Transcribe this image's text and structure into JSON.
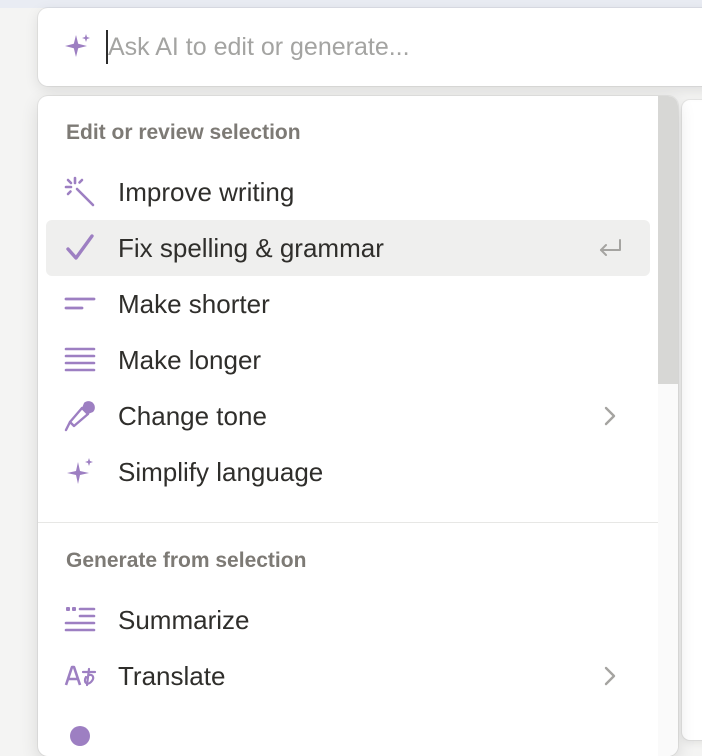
{
  "colors": {
    "accent": "#9d7fc2",
    "text": "#2f2e2b",
    "muted": "#7d7a75",
    "placeholder": "#a4a4a2",
    "selected_bg": "#efefee"
  },
  "ai_bar": {
    "icon": "sparkle-icon",
    "placeholder": "Ask AI to edit or generate..."
  },
  "menu": {
    "sections": [
      {
        "label": "Edit or review selection",
        "items": [
          {
            "label": "Improve writing",
            "icon": "magic-wand-icon"
          },
          {
            "label": "Fix spelling & grammar",
            "icon": "checkmark-icon",
            "selected": true,
            "trailing": "enter-key-icon"
          },
          {
            "label": "Make shorter",
            "icon": "short-lines-icon"
          },
          {
            "label": "Make longer",
            "icon": "long-lines-icon"
          },
          {
            "label": "Change tone",
            "icon": "microphone-icon",
            "trailing": "chevron-right-icon"
          },
          {
            "label": "Simplify language",
            "icon": "sparkle-icon"
          }
        ]
      },
      {
        "label": "Generate from selection",
        "items": [
          {
            "label": "Summarize",
            "icon": "quote-lines-icon"
          },
          {
            "label": "Translate",
            "icon": "translate-icon",
            "trailing": "chevron-right-icon"
          }
        ]
      }
    ]
  }
}
